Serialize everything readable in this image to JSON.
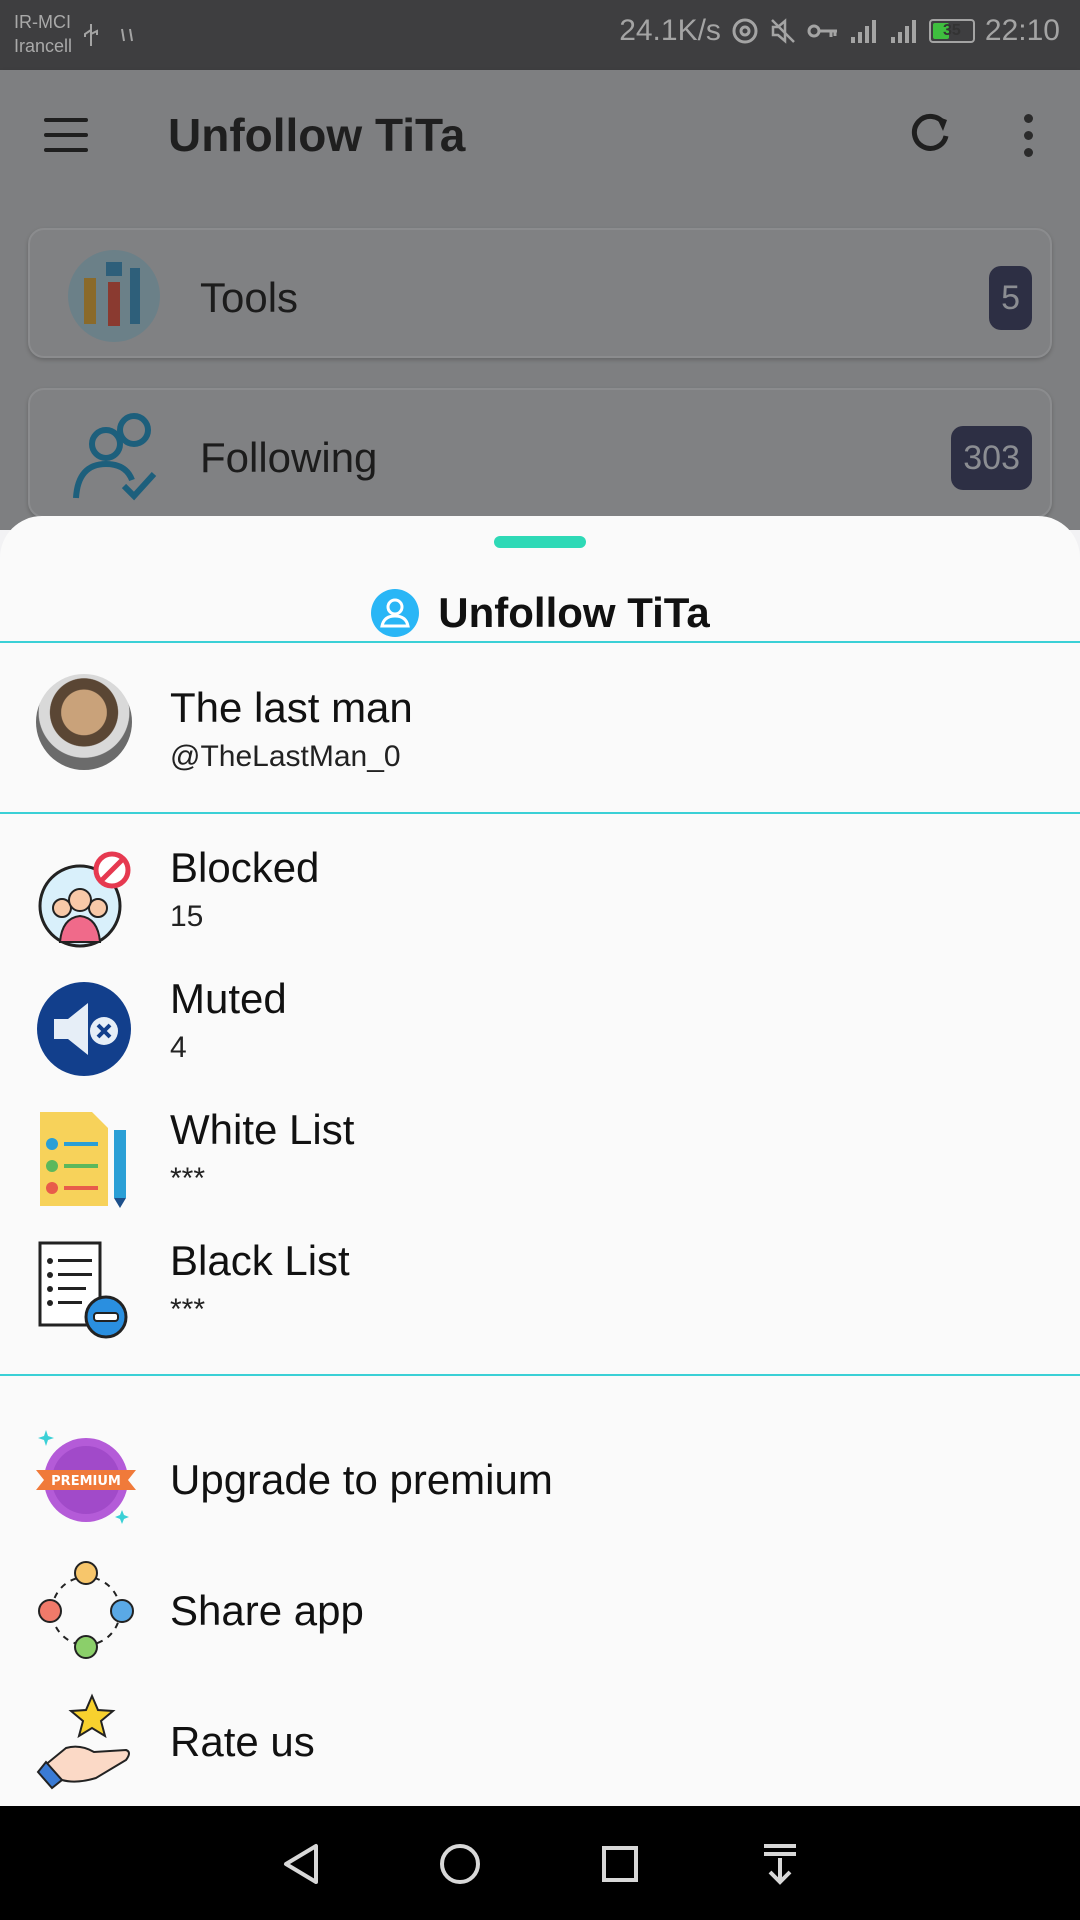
{
  "status_bar": {
    "carrier_line1": "IR-MCI",
    "carrier_line2": "Irancell",
    "speed": "24.1K/s",
    "battery_level": "35",
    "time": "22:10"
  },
  "app_bar": {
    "title": "Unfollow TiTa"
  },
  "background_cards": [
    {
      "label": "Tools",
      "badge": "5"
    },
    {
      "label": "Following",
      "badge": "303"
    }
  ],
  "sheet": {
    "title": "Unfollow TiTa",
    "profile": {
      "name": "The last man",
      "handle": "@TheLastMan_0"
    },
    "lists": [
      {
        "label": "Blocked",
        "count": "15",
        "icon": "blocked-users-icon"
      },
      {
        "label": "Muted",
        "count": "4",
        "icon": "muted-speaker-icon"
      },
      {
        "label": "White List",
        "count": "***",
        "icon": "checklist-icon"
      },
      {
        "label": "Black List",
        "count": "***",
        "icon": "blacklist-icon"
      }
    ],
    "actions": [
      {
        "label": "Upgrade to premium",
        "icon": "premium-badge-icon"
      },
      {
        "label": "Share app",
        "icon": "share-people-icon"
      },
      {
        "label": "Rate us",
        "icon": "rate-hand-star-icon"
      }
    ]
  },
  "colors": {
    "accent_teal": "#2ed9b6",
    "divider_cyan": "#3ad0d6",
    "title_icon_blue": "#29b6f6",
    "badge_bg": "#2d2f44"
  }
}
